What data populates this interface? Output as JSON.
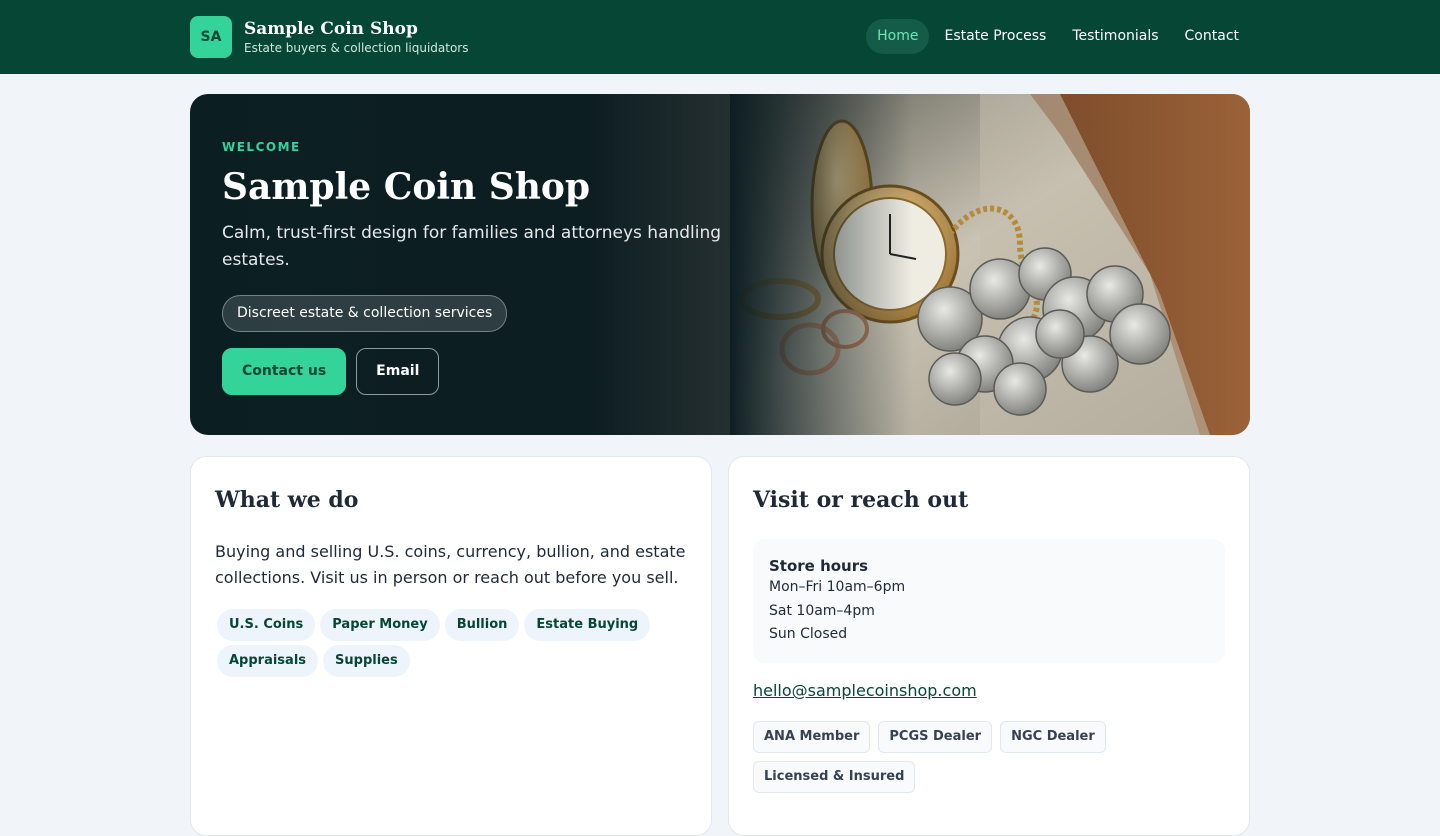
{
  "header": {
    "logo_initials": "SA",
    "brand_name": "Sample Coin Shop",
    "brand_tagline": "Estate buyers & collection liquidators",
    "nav": [
      {
        "label": "Home",
        "active": true
      },
      {
        "label": "Estate Process",
        "active": false
      },
      {
        "label": "Testimonials",
        "active": false
      },
      {
        "label": "Contact",
        "active": false
      }
    ]
  },
  "hero": {
    "eyebrow": "WELCOME",
    "title": "Sample Coin Shop",
    "subtitle": "Calm, trust-first design for families and attorneys handling estates.",
    "pill": "Discreet estate & collection services",
    "primary_button": "Contact us",
    "secondary_button": "Email",
    "image_subject": "pocket-watch-coins-rings-photo"
  },
  "what_we_do": {
    "title": "What we do",
    "body": "Buying and selling U.S. coins, currency, bullion, and estate collections. Visit us in person or reach out before you sell.",
    "tags": [
      "U.S. Coins",
      "Paper Money",
      "Bullion",
      "Estate Buying",
      "Appraisals",
      "Supplies"
    ]
  },
  "visit": {
    "title": "Visit or reach out",
    "hours_title": "Store hours",
    "hours": [
      "Mon–Fri 10am–6pm",
      "Sat 10am–4pm",
      "Sun Closed"
    ],
    "email": "hello@samplecoinshop.com",
    "badges": [
      "ANA Member",
      "PCGS Dealer",
      "NGC Dealer",
      "Licensed & Insured"
    ]
  },
  "colors": {
    "header_bg": "#064634",
    "accent": "#34d399",
    "page_bg": "#f1f5f9"
  }
}
